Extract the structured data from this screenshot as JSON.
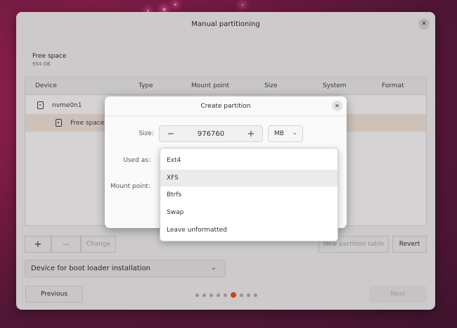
{
  "window": {
    "title": "Manual partitioning",
    "close_glyph": "✕"
  },
  "free_space": {
    "heading": "Free space",
    "size": "954 GB"
  },
  "table": {
    "headers": [
      "Device",
      "Type",
      "Mount point",
      "Size",
      "System",
      "Format"
    ],
    "rows": [
      {
        "device": "nvme0n1",
        "icon": "disk-icon"
      },
      {
        "device": "Free space",
        "icon": "disk-icon",
        "selected": true
      }
    ]
  },
  "toolbar": {
    "add_label": "+",
    "remove_label": "—",
    "change_label": "Change",
    "new_table_label": "New partition table",
    "revert_label": "Revert"
  },
  "bootloader": {
    "label": "Device for boot loader installation",
    "chevron_icon": "chevron-down-icon"
  },
  "footer": {
    "previous_label": "Previous",
    "next_label": "Next",
    "step_count": 9,
    "active_step": 6
  },
  "dialog": {
    "title": "Create partition",
    "close_glyph": "✕",
    "size_label": "Size:",
    "size_value": "976760",
    "minus_glyph": "−",
    "plus_glyph": "+",
    "unit": "MB",
    "used_as_label": "Used as:",
    "mount_point_label": "Mount point:"
  },
  "dropdown": {
    "options": [
      "Ext4",
      "XFS",
      "Btrfs",
      "Swap",
      "Leave unformatted"
    ],
    "hovered_index": 1
  },
  "colors": {
    "accent": "#e95420",
    "selected_row": "#f6e9e0"
  }
}
